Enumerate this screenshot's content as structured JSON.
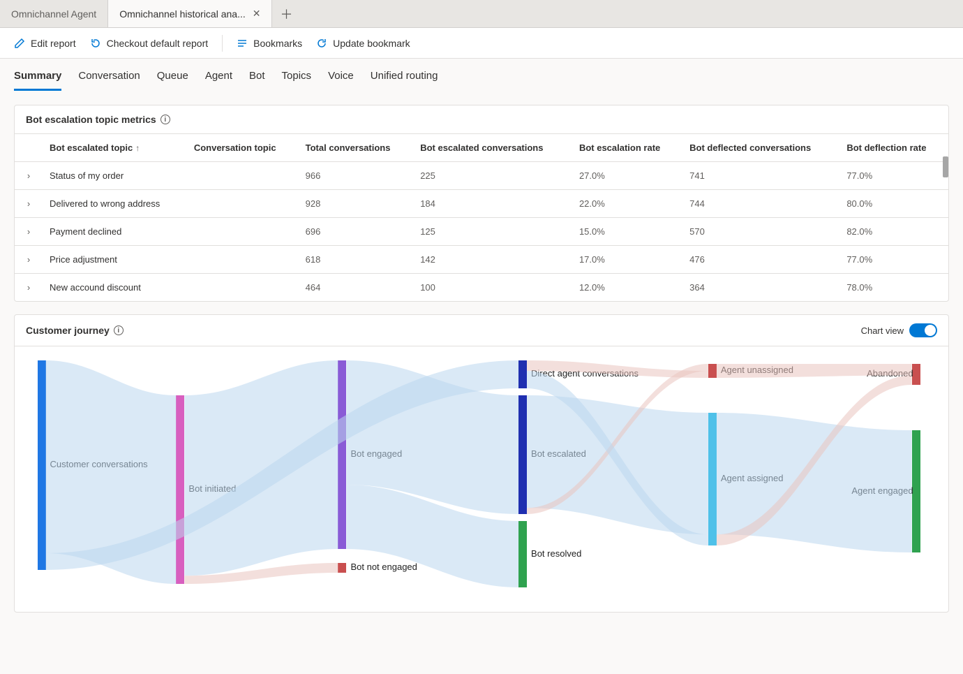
{
  "window_tabs": {
    "inactive": "Omnichannel Agent",
    "active": "Omnichannel historical ana..."
  },
  "toolbar": {
    "edit": "Edit report",
    "checkout": "Checkout default report",
    "bookmarks": "Bookmarks",
    "update": "Update bookmark"
  },
  "report_tabs": [
    "Summary",
    "Conversation",
    "Queue",
    "Agent",
    "Bot",
    "Topics",
    "Voice",
    "Unified routing"
  ],
  "metrics_card": {
    "title": "Bot escalation topic metrics",
    "columns": [
      "Bot escalated topic",
      "Conversation topic",
      "Total conversations",
      "Bot escalated conversations",
      "Bot escalation rate",
      "Bot deflected conversations",
      "Bot deflection rate"
    ],
    "rows": [
      {
        "topic": "Status of my order",
        "conv_topic": "",
        "total": "966",
        "escalated": "225",
        "esc_rate": "27.0%",
        "deflected": "741",
        "defl_rate": "77.0%"
      },
      {
        "topic": "Delivered to wrong address",
        "conv_topic": "",
        "total": "928",
        "escalated": "184",
        "esc_rate": "22.0%",
        "deflected": "744",
        "defl_rate": "80.0%"
      },
      {
        "topic": "Payment declined",
        "conv_topic": "",
        "total": "696",
        "escalated": "125",
        "esc_rate": "15.0%",
        "deflected": "570",
        "defl_rate": "82.0%"
      },
      {
        "topic": "Price adjustment",
        "conv_topic": "",
        "total": "618",
        "escalated": "142",
        "esc_rate": "17.0%",
        "deflected": "476",
        "defl_rate": "77.0%"
      },
      {
        "topic": "New accound discount",
        "conv_topic": "",
        "total": "464",
        "escalated": "100",
        "esc_rate": "12.0%",
        "deflected": "364",
        "defl_rate": "78.0%"
      }
    ]
  },
  "journey_card": {
    "title": "Customer journey",
    "chart_view_label": "Chart view"
  },
  "chart_data": {
    "type": "sankey",
    "nodes": [
      {
        "id": "customer",
        "label": "Customer conversations",
        "color": "#1f77e4"
      },
      {
        "id": "bot_initiated",
        "label": "Bot initiated",
        "color": "#d85fbf"
      },
      {
        "id": "bot_engaged",
        "label": "Bot engaged",
        "color": "#8a5bd6"
      },
      {
        "id": "bot_not_engaged",
        "label": "Bot not engaged",
        "color": "#c94f4f"
      },
      {
        "id": "direct_agent",
        "label": "Direct agent conversations",
        "color": "#1f2fb0"
      },
      {
        "id": "bot_escalated",
        "label": "Bot escalated",
        "color": "#1f2fb0"
      },
      {
        "id": "bot_resolved",
        "label": "Bot resolved",
        "color": "#2fa24f"
      },
      {
        "id": "agent_unassigned",
        "label": "Agent unassigned",
        "color": "#c94f4f"
      },
      {
        "id": "agent_assigned",
        "label": "Agent assigned",
        "color": "#4fc1e9"
      },
      {
        "id": "abandoned",
        "label": "Abandoned",
        "color": "#c94f4f"
      },
      {
        "id": "agent_engaged",
        "label": "Agent engaged",
        "color": "#2fa24f"
      }
    ],
    "flows": [
      {
        "from": "customer",
        "to": "bot_initiated",
        "value": 92,
        "color": "#bcd7ef"
      },
      {
        "from": "customer",
        "to": "direct_agent",
        "value": 8,
        "color": "#bcd7ef"
      },
      {
        "from": "bot_initiated",
        "to": "bot_engaged",
        "value": 88,
        "color": "#bcd7ef"
      },
      {
        "from": "bot_initiated",
        "to": "bot_not_engaged",
        "value": 4,
        "color": "#e9c5c0"
      },
      {
        "from": "bot_engaged",
        "to": "bot_escalated",
        "value": 58,
        "color": "#bcd7ef"
      },
      {
        "from": "bot_engaged",
        "to": "bot_resolved",
        "value": 30,
        "color": "#bcd7ef"
      },
      {
        "from": "bot_escalated",
        "to": "agent_assigned",
        "value": 55,
        "color": "#bcd7ef"
      },
      {
        "from": "bot_escalated",
        "to": "agent_unassigned",
        "value": 3,
        "color": "#e9c5c0"
      },
      {
        "from": "direct_agent",
        "to": "agent_unassigned",
        "value": 3,
        "color": "#e9c5c0"
      },
      {
        "from": "direct_agent",
        "to": "agent_assigned",
        "value": 5,
        "color": "#bcd7ef"
      },
      {
        "from": "agent_unassigned",
        "to": "abandoned",
        "value": 6,
        "color": "#e9c5c0"
      },
      {
        "from": "agent_assigned",
        "to": "agent_engaged",
        "value": 55,
        "color": "#bcd7ef"
      },
      {
        "from": "agent_assigned",
        "to": "abandoned",
        "value": 5,
        "color": "#e9c5c0"
      }
    ]
  }
}
